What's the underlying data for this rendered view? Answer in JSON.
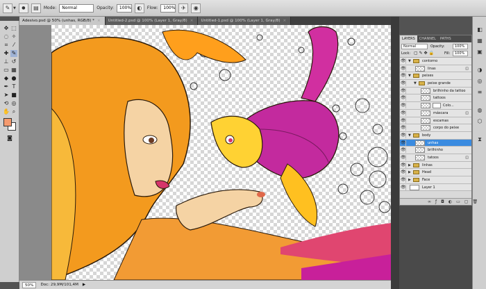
{
  "options_bar": {
    "mode_label": "Mode:",
    "mode_value": "Normal",
    "opacity_label": "Opacity:",
    "opacity_value": "100%",
    "flow_label": "Flow:",
    "flow_value": "100%"
  },
  "tabs": [
    {
      "label": "Adesivo.psd @ 50% (unhas, RGB/8) *",
      "active": true
    },
    {
      "label": "Untitled-2.psd @ 100% (Layer 1, Gray/8)",
      "active": false
    },
    {
      "label": "Untitled-1.psd @ 100% (Layer 1, Gray/8)",
      "active": false
    }
  ],
  "status_bar": {
    "zoom": "50%",
    "doc": "Doc: 29,9M/101,4M"
  },
  "layers_panel": {
    "tabs": [
      "LAYERS",
      "CHANNEL",
      "PATHS"
    ],
    "blend_mode": "Normal",
    "opacity_label": "Opacity:",
    "opacity_value": "100%",
    "lock_label": "Lock:",
    "fill_label": "Fill:",
    "fill_value": "100%",
    "layers": [
      {
        "name": "contorno",
        "kind": "group",
        "indent": 0,
        "expanded": true,
        "selected": false,
        "fx": false
      },
      {
        "name": "linas",
        "kind": "layer",
        "indent": 1,
        "selected": false,
        "fx": true
      },
      {
        "name": "peixes",
        "kind": "group",
        "indent": 0,
        "expanded": true,
        "selected": false,
        "fx": false
      },
      {
        "name": "peixe grande",
        "kind": "group",
        "indent": 1,
        "expanded": true,
        "selected": false,
        "fx": false
      },
      {
        "name": "brilhinho da tattoo",
        "kind": "layer",
        "indent": 2,
        "selected": false,
        "fx": false
      },
      {
        "name": "tattoos",
        "kind": "layer",
        "indent": 2,
        "selected": false,
        "fx": false
      },
      {
        "name": "Colo...",
        "kind": "adjustment",
        "indent": 2,
        "selected": false,
        "fx": false
      },
      {
        "name": "máscara",
        "kind": "layer",
        "indent": 2,
        "selected": false,
        "fx": true
      },
      {
        "name": "escamas",
        "kind": "layer",
        "indent": 2,
        "selected": false,
        "fx": false
      },
      {
        "name": "corpo do peixe",
        "kind": "layer",
        "indent": 2,
        "selected": false,
        "fx": false
      },
      {
        "name": "body",
        "kind": "group",
        "indent": 0,
        "expanded": true,
        "selected": false,
        "fx": false
      },
      {
        "name": "unhas",
        "kind": "layer",
        "indent": 1,
        "selected": true,
        "fx": false
      },
      {
        "name": "brilhinho",
        "kind": "layer",
        "indent": 1,
        "selected": false,
        "fx": false
      },
      {
        "name": "tatoos",
        "kind": "layer",
        "indent": 1,
        "selected": false,
        "fx": true
      },
      {
        "name": "linhas",
        "kind": "group",
        "indent": 0,
        "expanded": false,
        "selected": false,
        "fx": false
      },
      {
        "name": "Head",
        "kind": "group",
        "indent": 0,
        "expanded": false,
        "selected": false,
        "fx": false
      },
      {
        "name": "Face",
        "kind": "group",
        "indent": 0,
        "expanded": false,
        "selected": false,
        "fx": false
      },
      {
        "name": "Layer 1",
        "kind": "white",
        "indent": 0,
        "selected": false,
        "fx": false
      }
    ]
  },
  "colors": {
    "foreground": "#f49a6f",
    "background": "#ffffff",
    "selected_layer": "#3a8be0"
  },
  "icons": {
    "tool_options": "brush-icon",
    "visibility": "eye-icon"
  }
}
